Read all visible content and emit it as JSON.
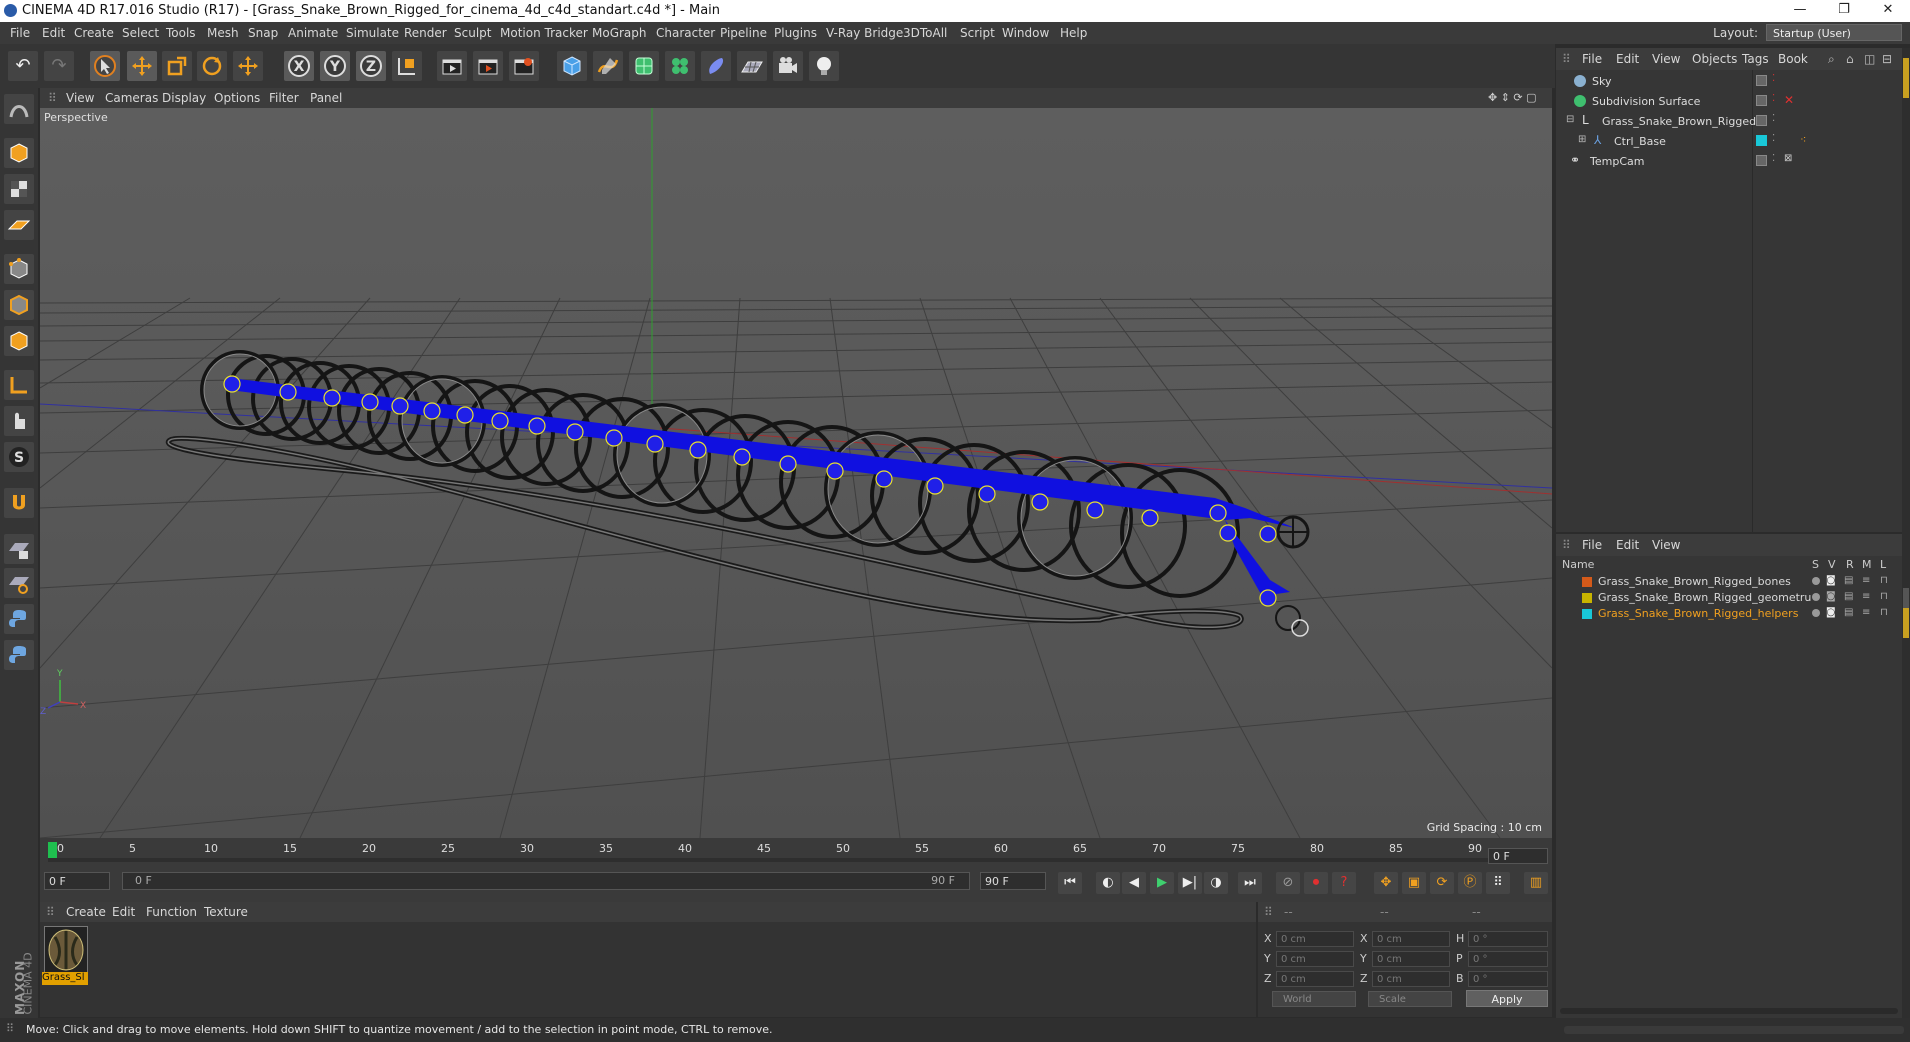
{
  "window": {
    "title": "CINEMA 4D R17.016 Studio (R17) - [Grass_Snake_Brown_Rigged_for_cinema_4d_c4d_standart.c4d *] - Main",
    "minimize": "—",
    "restore": "❐",
    "close": "✕"
  },
  "menubar": {
    "items": [
      "File",
      "Edit",
      "Create",
      "Select",
      "Tools",
      "Mesh",
      "Snap",
      "Animate",
      "Simulate",
      "Render",
      "Sculpt",
      "Motion Tracker",
      "MoGraph",
      "Character",
      "Pipeline",
      "Plugins",
      "V-Ray Bridge",
      "3DToAll",
      "Script",
      "Window",
      "Help"
    ],
    "layout_label": "Layout:",
    "layout_value": "Startup (User)"
  },
  "toolbar": {
    "icons": [
      "undo-icon",
      "redo-icon",
      "select-arrow-icon",
      "move-icon",
      "scale-icon",
      "rotate-icon",
      "add-icon",
      "x-axis-icon",
      "y-axis-icon",
      "z-axis-icon",
      "coordinate-system-icon",
      "render-view-icon",
      "render-picture-viewer-icon",
      "render-settings-icon",
      "cube-primitive-icon",
      "pen-spline-icon",
      "subdivision-icon",
      "cloner-icon",
      "deformer-icon",
      "floor-icon",
      "camera-icon",
      "light-icon"
    ],
    "axis_x": "X",
    "axis_y": "Y",
    "axis_z": "Z"
  },
  "viewport": {
    "menu": [
      "View",
      "Cameras",
      "Display",
      "Options",
      "Filter",
      "Panel"
    ],
    "label": "Perspective",
    "grid_spacing": "Grid Spacing : 10 cm"
  },
  "timeline": {
    "ticks": [
      "0",
      "5",
      "10",
      "15",
      "20",
      "25",
      "30",
      "35",
      "40",
      "45",
      "50",
      "55",
      "60",
      "65",
      "70",
      "75",
      "80",
      "85",
      "90"
    ],
    "current_frame": "0 F"
  },
  "playback": {
    "start_field": "0 F",
    "range_start": "0 F",
    "range_end": "90 F",
    "end_field": "90 F"
  },
  "material_manager": {
    "menu": [
      "Create",
      "Edit",
      "Function",
      "Texture"
    ],
    "material_name": "Grass_Sl"
  },
  "coordinates": {
    "header": [
      "--",
      "--",
      "--"
    ],
    "rows": [
      {
        "l1": "X",
        "v1": "0 cm",
        "l2": "X",
        "v2": "0 cm",
        "l3": "H",
        "v3": "0 °"
      },
      {
        "l1": "Y",
        "v1": "0 cm",
        "l2": "Y",
        "v2": "0 cm",
        "l3": "P",
        "v3": "0 °"
      },
      {
        "l1": "Z",
        "v1": "0 cm",
        "l2": "Z",
        "v2": "0 cm",
        "l3": "B",
        "v3": "0 °"
      }
    ],
    "mode1": "World",
    "mode2": "Scale",
    "apply": "Apply"
  },
  "object_manager": {
    "menu": [
      "File",
      "Edit",
      "View",
      "Objects",
      "Tags",
      "Book"
    ],
    "objects": [
      {
        "name": "Sky",
        "color": "#8ab0d0"
      },
      {
        "name": "Subdivision Surface",
        "color": "#3fbf6f"
      },
      {
        "name": "Grass_Snake_Brown_Rigged",
        "color": "#b0b0b0"
      },
      {
        "name": "Ctrl_Base",
        "color": "#6aa0e0"
      },
      {
        "name": "TempCam",
        "color": "#b0b0b0"
      }
    ]
  },
  "layer_manager": {
    "menu": [
      "File",
      "Edit",
      "View"
    ],
    "columns": {
      "name": "Name",
      "s": "S",
      "v": "V",
      "r": "R",
      "m": "M",
      "l": "L"
    },
    "layers": [
      {
        "name": "Grass_Snake_Brown_Rigged_bones",
        "color": "#d45a1a",
        "text_color": "#d8d8d8"
      },
      {
        "name": "Grass_Snake_Brown_Rigged_geometru",
        "color": "#c8b400",
        "text_color": "#d8d8d8"
      },
      {
        "name": "Grass_Snake_Brown_Rigged_helpers",
        "color": "#19c8d8",
        "text_color": "#f0a020"
      }
    ]
  },
  "status": {
    "text": "Move: Click and drag to move elements. Hold down SHIFT to quantize movement / add to the selection in point mode, CTRL to remove."
  },
  "branding": {
    "maxon": "MAXON",
    "cinema": "CINEMA 4D"
  }
}
